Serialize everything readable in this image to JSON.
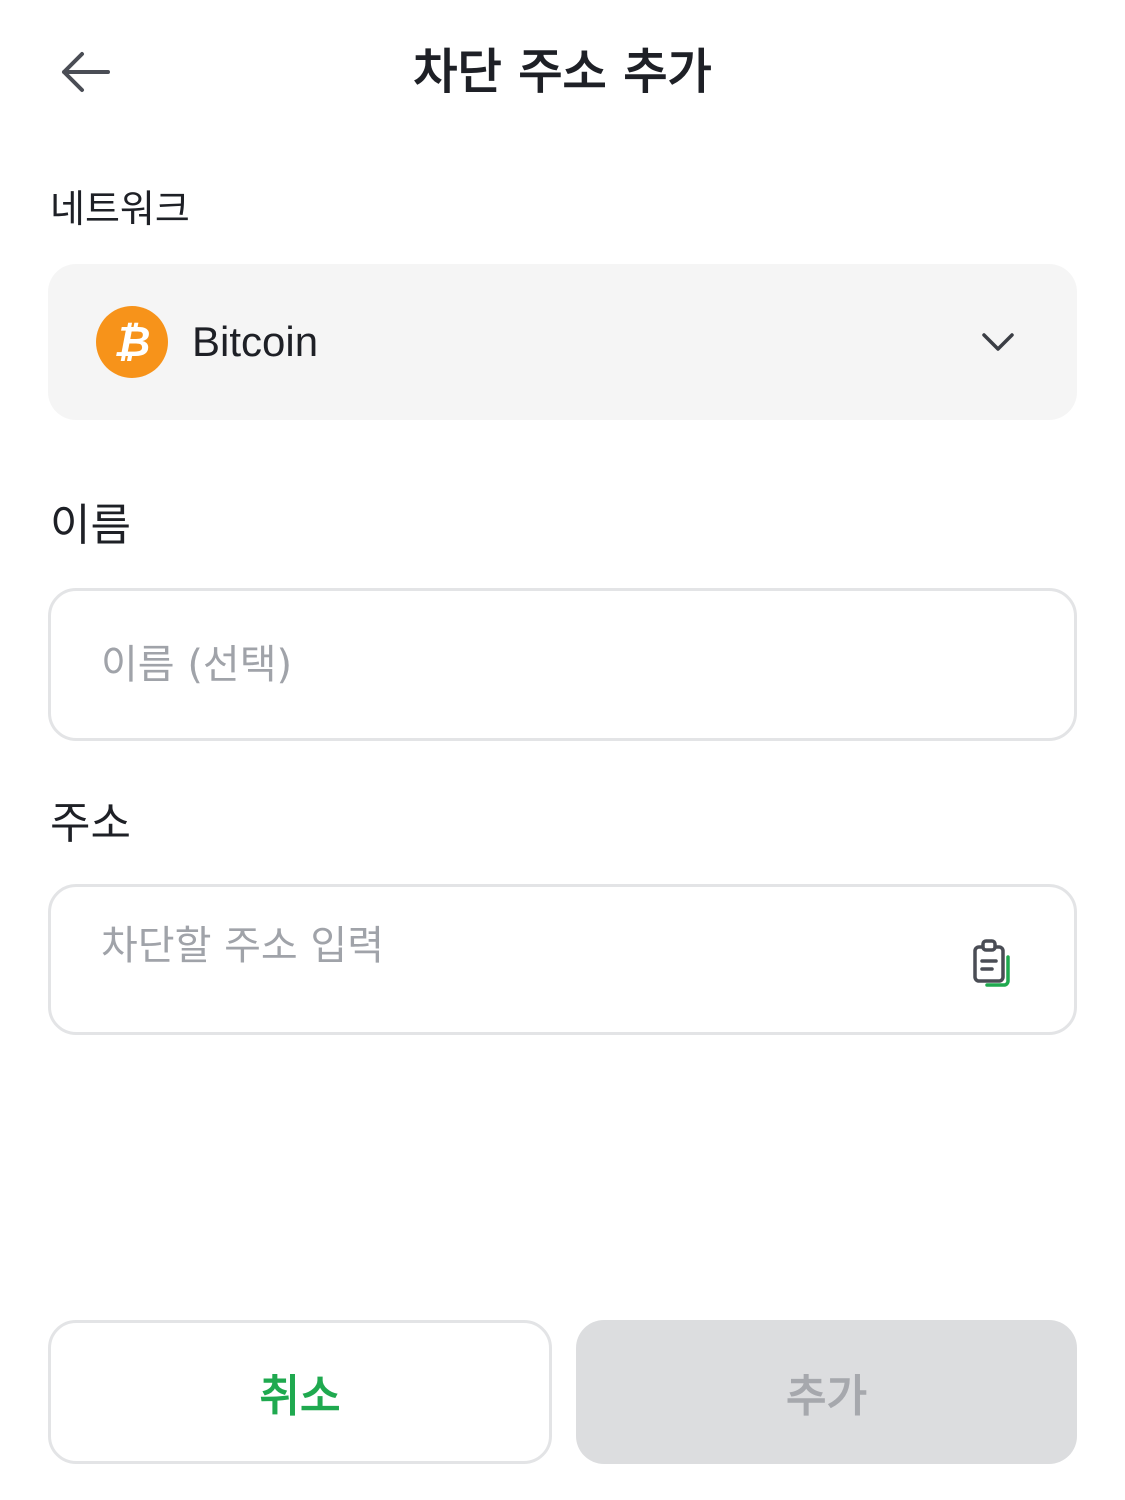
{
  "header": {
    "title": "차단 주소 추가",
    "back_icon": "arrow-left-icon"
  },
  "network": {
    "label": "네트워크",
    "selected": "Bitcoin",
    "coin_icon": "bitcoin-icon",
    "dropdown_icon": "chevron-down-icon"
  },
  "name_field": {
    "label": "이름",
    "placeholder": "이름 (선택)",
    "value": ""
  },
  "address_field": {
    "label": "주소",
    "placeholder": "차단할 주소 입력",
    "value": "",
    "paste_icon": "clipboard-paste-icon"
  },
  "actions": {
    "cancel_label": "취소",
    "add_label": "추가"
  },
  "colors": {
    "accent_green": "#1fa94f",
    "bitcoin_orange": "#f7931a",
    "disabled_bg": "#dcdddf",
    "disabled_text": "#a6a8ad",
    "field_border": "#e3e4e6",
    "select_bg": "#f5f5f5"
  }
}
